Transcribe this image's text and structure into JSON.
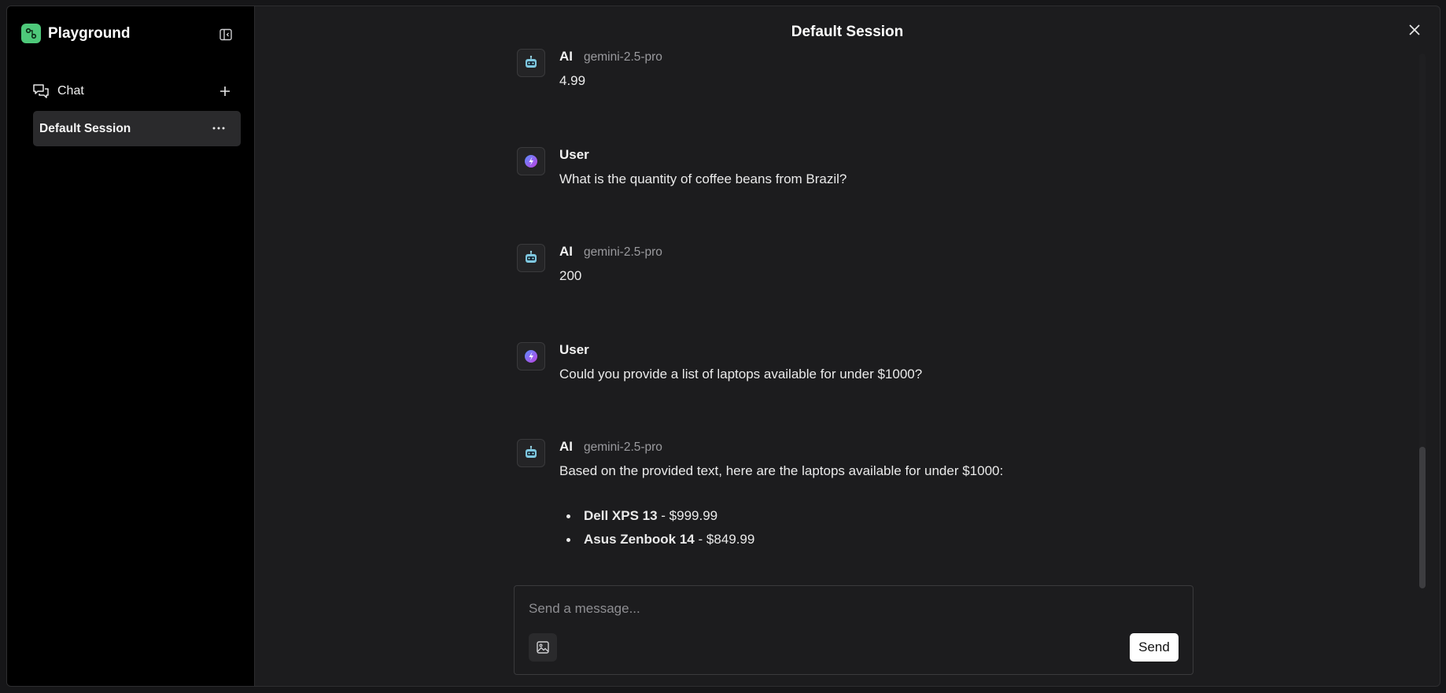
{
  "sidebar": {
    "brand": "Playground",
    "chat_label": "Chat",
    "sessions": [
      {
        "label": "Default Session",
        "selected": true
      }
    ]
  },
  "header": {
    "title": "Default Session"
  },
  "messages": [
    {
      "sender": "AI",
      "model": "gemini-2.5-pro",
      "text": "4.99"
    },
    {
      "sender": "User",
      "text": "What is the quantity of coffee beans from Brazil?"
    },
    {
      "sender": "AI",
      "model": "gemini-2.5-pro",
      "text": "200"
    },
    {
      "sender": "User",
      "text": "Could you provide a list of laptops available for under $1000?"
    },
    {
      "sender": "AI",
      "model": "gemini-2.5-pro",
      "text": "Based on the provided text, here are the laptops available for under $1000:",
      "list": [
        {
          "name": "Dell XPS 13",
          "price": " - $999.99"
        },
        {
          "name": "Asus Zenbook 14",
          "price": " - $849.99"
        }
      ]
    }
  ],
  "composer": {
    "placeholder": "Send a message...",
    "send_label": "Send"
  },
  "colors": {
    "brand_accent": "#4ec97a",
    "background": "#1c1c1e",
    "sidebar": "#000000"
  }
}
